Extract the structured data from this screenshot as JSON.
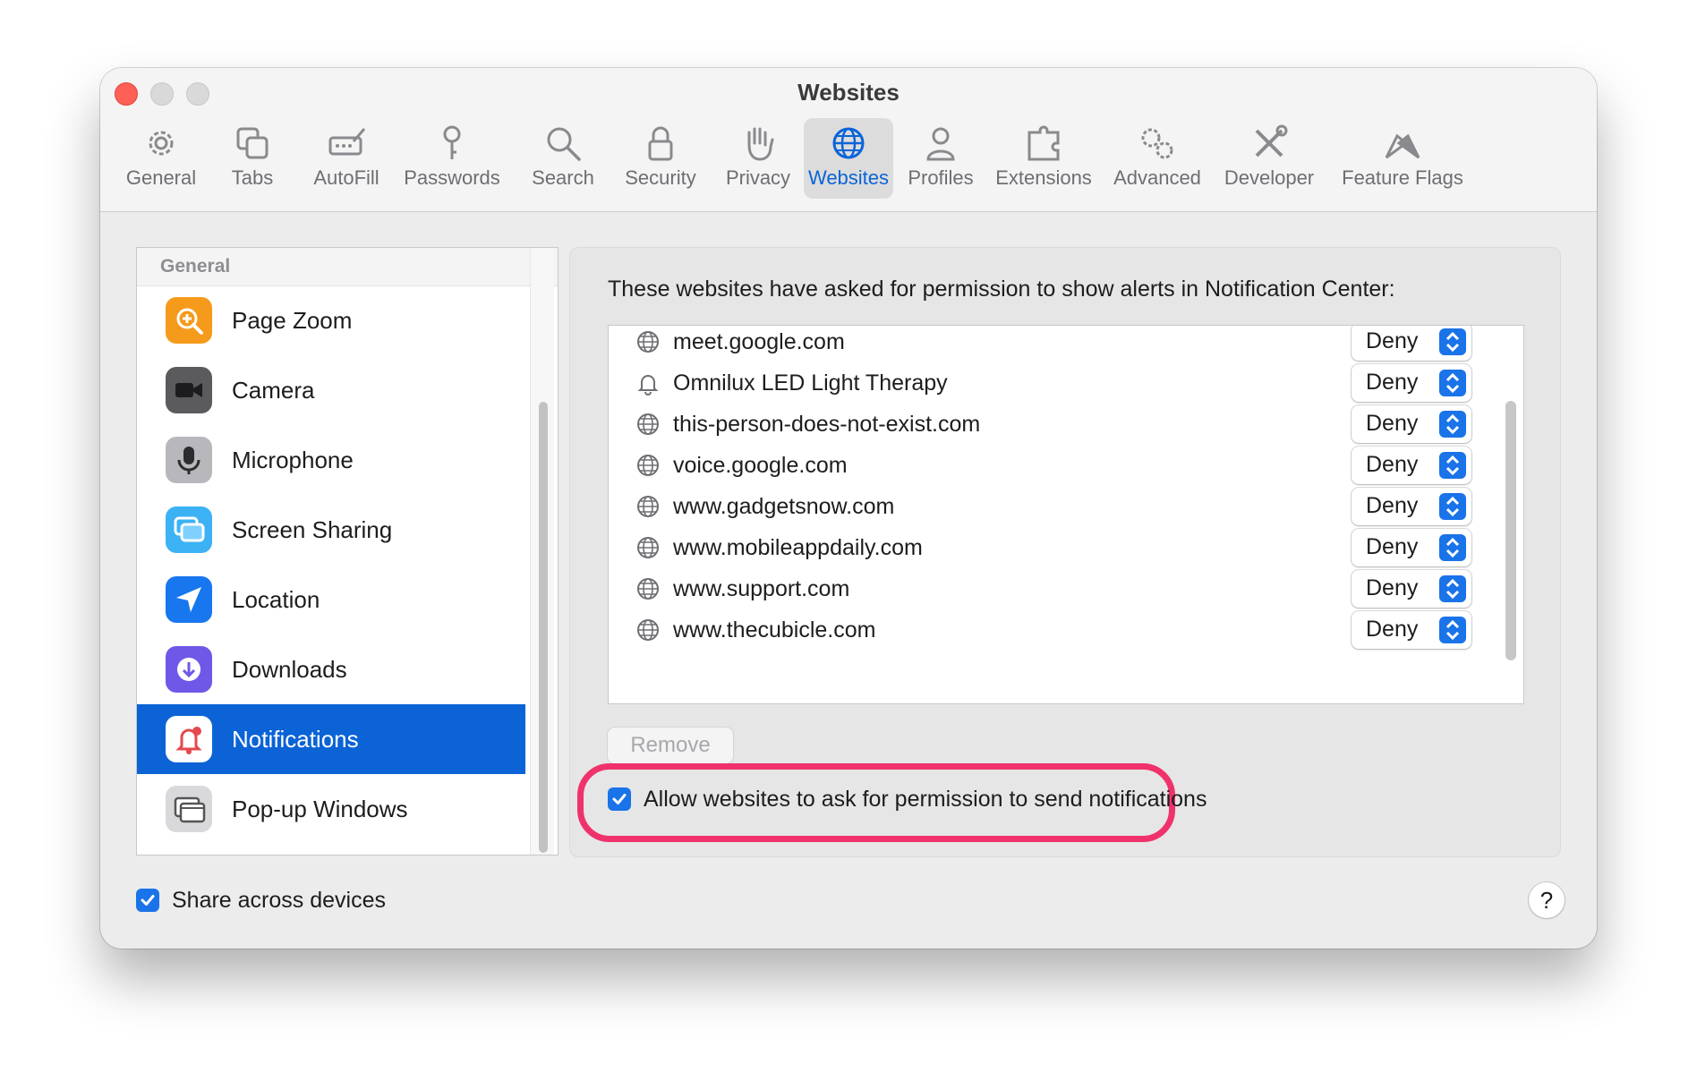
{
  "window": {
    "title": "Websites"
  },
  "toolbar": {
    "tabs": [
      {
        "label": "General",
        "icon": "gear-icon"
      },
      {
        "label": "Tabs",
        "icon": "tabs-icon"
      },
      {
        "label": "AutoFill",
        "icon": "autofill-icon"
      },
      {
        "label": "Passwords",
        "icon": "key-icon"
      },
      {
        "label": "Search",
        "icon": "search-icon"
      },
      {
        "label": "Security",
        "icon": "lock-icon"
      },
      {
        "label": "Privacy",
        "icon": "hand-icon"
      },
      {
        "label": "Websites",
        "icon": "globe-icon",
        "active": true
      },
      {
        "label": "Profiles",
        "icon": "person-icon"
      },
      {
        "label": "Extensions",
        "icon": "puzzle-icon"
      },
      {
        "label": "Advanced",
        "icon": "gears-icon"
      },
      {
        "label": "Developer",
        "icon": "tools-icon"
      },
      {
        "label": "Feature Flags",
        "icon": "flags-icon"
      }
    ]
  },
  "sidebar": {
    "header": "General",
    "items": [
      {
        "label": "Page Zoom",
        "icon": "magnifier-icon",
        "color": "#f59a1b"
      },
      {
        "label": "Camera",
        "icon": "camera-icon",
        "color": "#5b5b5e"
      },
      {
        "label": "Microphone",
        "icon": "microphone-icon",
        "color": "#b8b8bc"
      },
      {
        "label": "Screen Sharing",
        "icon": "screen-sharing-icon",
        "color": "#3cb2f5"
      },
      {
        "label": "Location",
        "icon": "location-arrow-icon",
        "color": "#1877ef"
      },
      {
        "label": "Downloads",
        "icon": "download-icon",
        "color": "#6f58e8"
      },
      {
        "label": "Notifications",
        "icon": "bell-icon",
        "color": "#ffffff",
        "selected": true
      },
      {
        "label": "Pop-up Windows",
        "icon": "popup-windows-icon",
        "color": "#d9d9dc"
      }
    ]
  },
  "main": {
    "description": "These websites have asked for permission to show alerts in Notification Center:",
    "sites": [
      {
        "name": "meet.google.com",
        "icon": "globe-icon",
        "setting": "Deny"
      },
      {
        "name": "Omnilux LED Light Therapy",
        "icon": "bell-icon",
        "setting": "Deny"
      },
      {
        "name": "this-person-does-not-exist.com",
        "icon": "globe-icon",
        "setting": "Deny"
      },
      {
        "name": "voice.google.com",
        "icon": "globe-icon",
        "setting": "Deny"
      },
      {
        "name": "www.gadgetsnow.com",
        "icon": "globe-icon",
        "setting": "Deny"
      },
      {
        "name": "www.mobileappdaily.com",
        "icon": "globe-icon",
        "setting": "Deny"
      },
      {
        "name": "www.support.com",
        "icon": "globe-icon",
        "setting": "Deny"
      },
      {
        "name": "www.thecubicle.com",
        "icon": "globe-icon",
        "setting": "Deny"
      }
    ],
    "remove_label": "Remove",
    "allow_label": "Allow websites to ask for permission to send notifications",
    "allow_checked": true
  },
  "footer": {
    "share_label": "Share across devices",
    "share_checked": true,
    "help_label": "?"
  },
  "colors": {
    "accent": "#1a73e8",
    "selection": "#0b63d6",
    "highlight": "#f0326c"
  }
}
